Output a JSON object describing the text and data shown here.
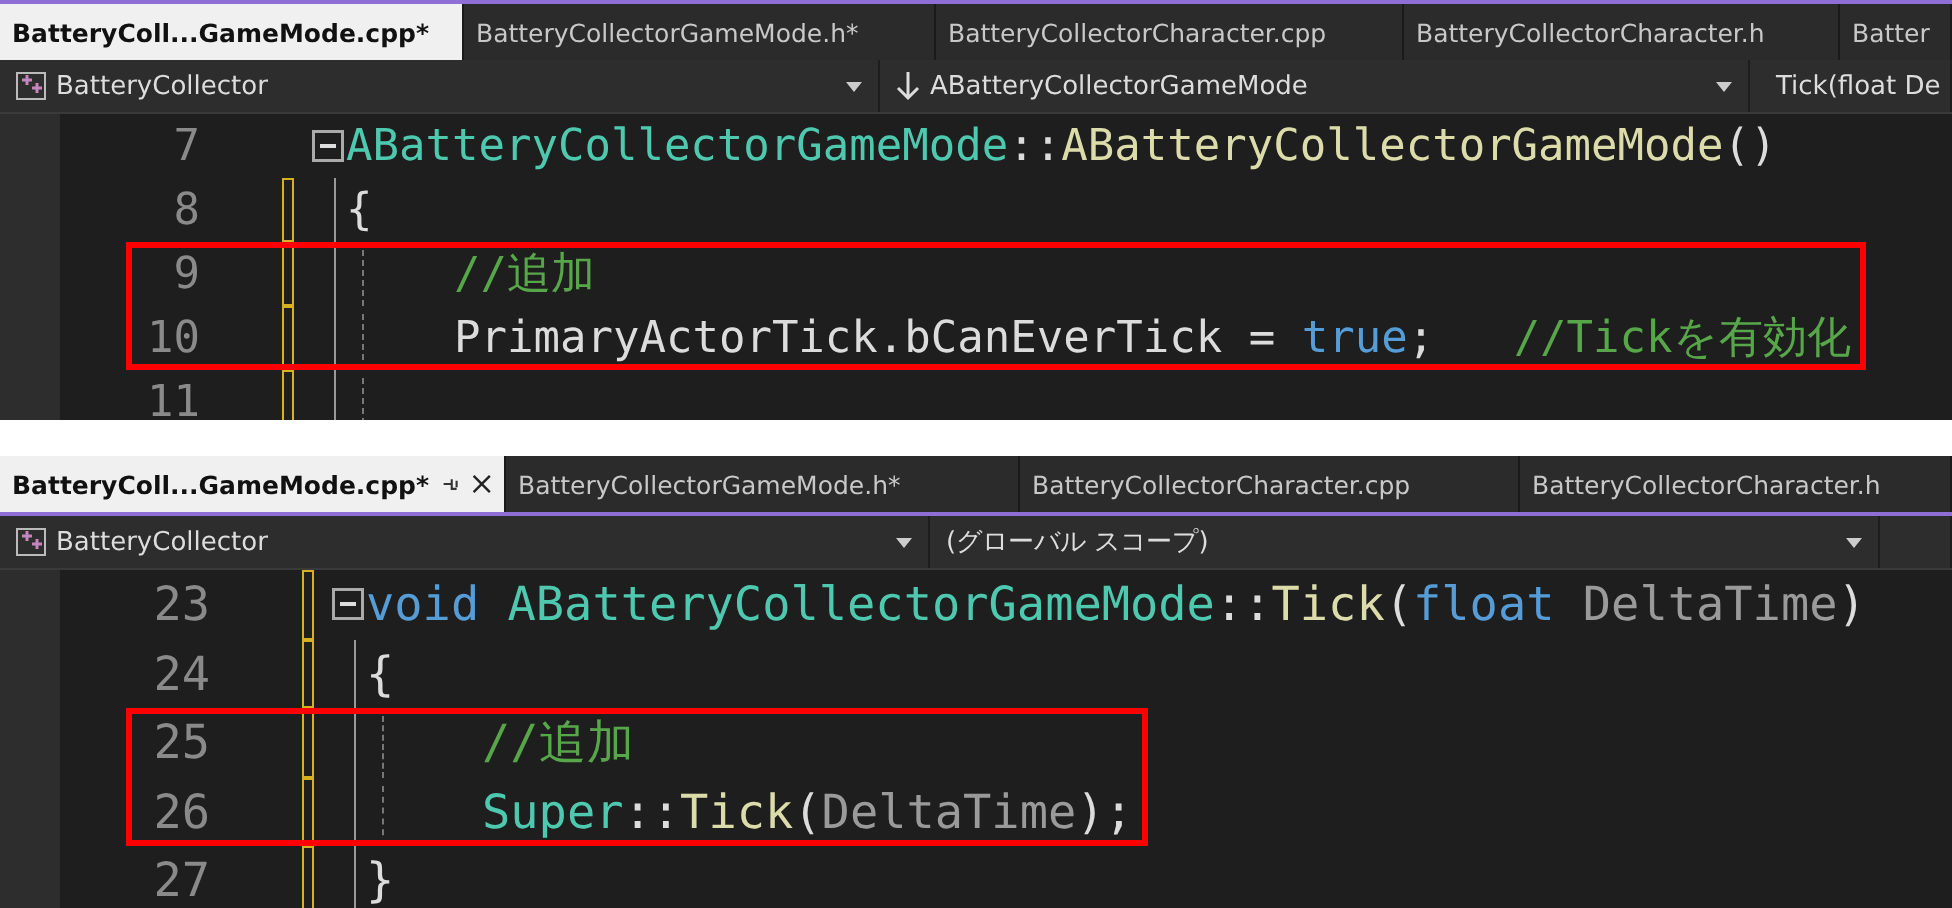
{
  "panels": [
    {
      "tabs": [
        {
          "label": "BatteryColl...GameMode.cpp*",
          "selected": true
        },
        {
          "label": "BatteryCollectorGameMode.h*",
          "selected": false
        },
        {
          "label": "BatteryCollectorCharacter.cpp",
          "selected": false
        },
        {
          "label": "BatteryCollectorCharacter.h",
          "selected": false
        },
        {
          "label": "Batter",
          "selected": false
        }
      ],
      "nav": [
        {
          "kind": "project",
          "label": "BatteryCollector",
          "dropdown": true
        },
        {
          "kind": "class",
          "label": "ABatteryCollectorGameMode",
          "dropdown": true
        },
        {
          "kind": "member",
          "label": "Tick(float De"
        }
      ],
      "lines": [
        {
          "number": "7",
          "fold": true,
          "modified": false,
          "indented": false,
          "highlighted": false,
          "tokens": [
            {
              "kind": "type",
              "text": "ABatteryCollectorGameMode"
            },
            {
              "kind": "plain",
              "text": "::"
            },
            {
              "kind": "func",
              "text": "ABatteryCollectorGameMode"
            },
            {
              "kind": "plain",
              "text": "()"
            }
          ]
        },
        {
          "number": "8",
          "fold": false,
          "modified": true,
          "indented": false,
          "highlighted": false,
          "tokens": [
            {
              "kind": "plain",
              "text": "{"
            }
          ]
        },
        {
          "number": "9",
          "fold": false,
          "modified": true,
          "indented": true,
          "highlighted": true,
          "tokens": [
            {
              "kind": "comment",
              "text": "//追加"
            }
          ]
        },
        {
          "number": "10",
          "fold": false,
          "modified": true,
          "indented": true,
          "highlighted": true,
          "tokens": [
            {
              "kind": "plain",
              "text": "PrimaryActorTick.bCanEverTick = "
            },
            {
              "kind": "keyword",
              "text": "true"
            },
            {
              "kind": "plain",
              "text": ";   "
            },
            {
              "kind": "comment",
              "text": "//Tickを有効化"
            }
          ]
        },
        {
          "number": "11",
          "fold": false,
          "modified": true,
          "indented": true,
          "highlighted": false
        }
      ]
    },
    {
      "tabs": [
        {
          "label": "BatteryColl...GameMode.cpp*",
          "selected": true
        },
        {
          "label": "BatteryCollectorGameMode.h*",
          "selected": false
        },
        {
          "label": "BatteryCollectorCharacter.cpp",
          "selected": false
        },
        {
          "label": "BatteryCollectorCharacter.h",
          "selected": false
        }
      ],
      "nav": [
        {
          "kind": "project",
          "label": "BatteryCollector",
          "dropdown": true
        },
        {
          "kind": "scope",
          "label": "(グローバル スコープ)",
          "dropdown": true
        }
      ],
      "lines": [
        {
          "number": "23",
          "fold": true,
          "modified": true,
          "indented": false,
          "highlighted": false,
          "tokens": [
            {
              "kind": "keyword",
              "text": "void "
            },
            {
              "kind": "type",
              "text": "ABatteryCollectorGameMode"
            },
            {
              "kind": "plain",
              "text": "::"
            },
            {
              "kind": "func",
              "text": "Tick"
            },
            {
              "kind": "plain",
              "text": "("
            },
            {
              "kind": "keyword",
              "text": "float "
            },
            {
              "kind": "param",
              "text": "DeltaTime"
            },
            {
              "kind": "plain",
              "text": ")"
            }
          ]
        },
        {
          "number": "24",
          "fold": false,
          "modified": true,
          "indented": false,
          "highlighted": false,
          "tokens": [
            {
              "kind": "plain",
              "text": "{"
            }
          ]
        },
        {
          "number": "25",
          "fold": false,
          "modified": true,
          "indented": true,
          "highlighted": true,
          "tokens": [
            {
              "kind": "comment",
              "text": "//追加"
            }
          ]
        },
        {
          "number": "26",
          "fold": false,
          "modified": true,
          "indented": true,
          "highlighted": true,
          "tokens": [
            {
              "kind": "type",
              "text": "Super"
            },
            {
              "kind": "plain",
              "text": "::"
            },
            {
              "kind": "func",
              "text": "Tick"
            },
            {
              "kind": "plain",
              "text": "("
            },
            {
              "kind": "param",
              "text": "DeltaTime"
            },
            {
              "kind": "plain",
              "text": ");"
            }
          ]
        },
        {
          "number": "27",
          "fold": false,
          "modified": true,
          "indented": false,
          "highlighted": false,
          "tokens": [
            {
              "kind": "plain",
              "text": "}"
            }
          ]
        }
      ]
    }
  ]
}
